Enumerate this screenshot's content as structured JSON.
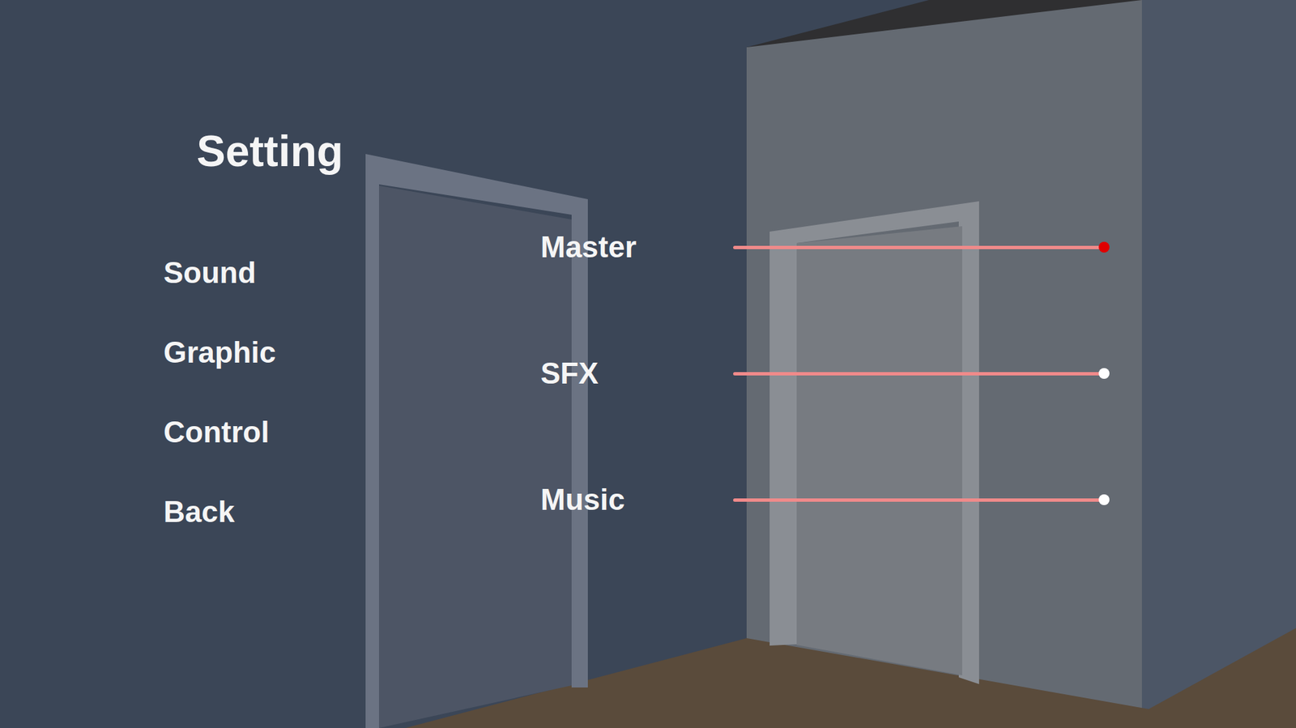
{
  "title": "Setting",
  "menu": [
    {
      "label": "Sound"
    },
    {
      "label": "Graphic"
    },
    {
      "label": "Control"
    },
    {
      "label": "Back"
    }
  ],
  "sliders": [
    {
      "label": "Master",
      "level": 1.0,
      "selected": true
    },
    {
      "label": "SFX",
      "level": 1.0,
      "selected": false
    },
    {
      "label": "Music",
      "level": 1.0,
      "selected": false
    }
  ]
}
